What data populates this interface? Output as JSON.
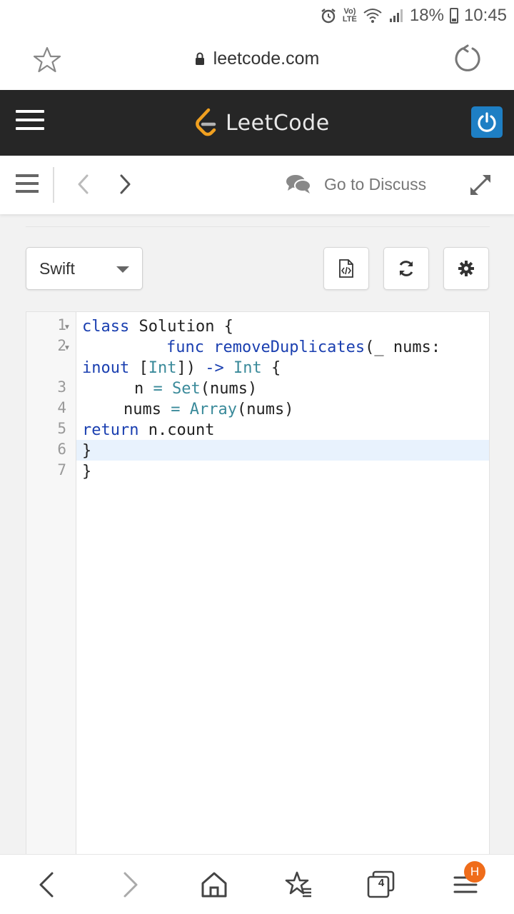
{
  "status_bar": {
    "lte_top": "Vo)",
    "lte_bottom": "LTE",
    "battery": "18%",
    "time": "10:45",
    "icons": [
      "alarm-icon",
      "volte-icon",
      "wifi-icon",
      "signal-icon",
      "battery-icon"
    ]
  },
  "browser": {
    "url": "leetcode.com",
    "icons": [
      "star-icon",
      "lock-icon",
      "reload-icon"
    ]
  },
  "header": {
    "logo_text": "LeetCode",
    "accent": "#1e7fc4",
    "logo_orange": "#f0a020"
  },
  "toolbar": {
    "discuss_label": "Go to Discuss",
    "icons": [
      "menu-icon",
      "chevron-left-icon",
      "chevron-right-icon",
      "comments-icon",
      "expand-icon"
    ]
  },
  "editor": {
    "language": "Swift",
    "buttons": [
      "code-file-icon",
      "refresh-icon",
      "gear-icon"
    ],
    "line_numbers": [
      "1",
      "2",
      "3",
      "4",
      "5",
      "6",
      "7"
    ],
    "code": {
      "line1_kw": "class",
      "line1_rest": " Solution {",
      "line2_kw": "func",
      "line2_fn": "removeDuplicates",
      "line2_rest": "(_ nums:",
      "line2b_kw": "inout",
      "line2b_open": " [",
      "line2b_type": "Int",
      "line2b_mid": "]) ",
      "line2b_arrow": "->",
      "line2b_space": " ",
      "line2b_ret": "Int",
      "line2b_close": " {",
      "line3_lead": "n ",
      "line3_eq": "=",
      "line3_sp": " ",
      "line3_type": "Set",
      "line3_rest": "(nums)",
      "line4_lead": "nums ",
      "line4_eq": "=",
      "line4_sp": " ",
      "line4_type": "Array",
      "line4_rest": "(nums)",
      "line5_kw": "return",
      "line5_rest": " n.count",
      "line6": "}",
      "line7": "}"
    }
  },
  "bottom_nav": {
    "tabs_count": "4",
    "badge": "H",
    "icons": [
      "back-icon",
      "forward-icon",
      "home-icon",
      "bookmarks-icon",
      "tabs-icon",
      "menu-icon"
    ]
  }
}
